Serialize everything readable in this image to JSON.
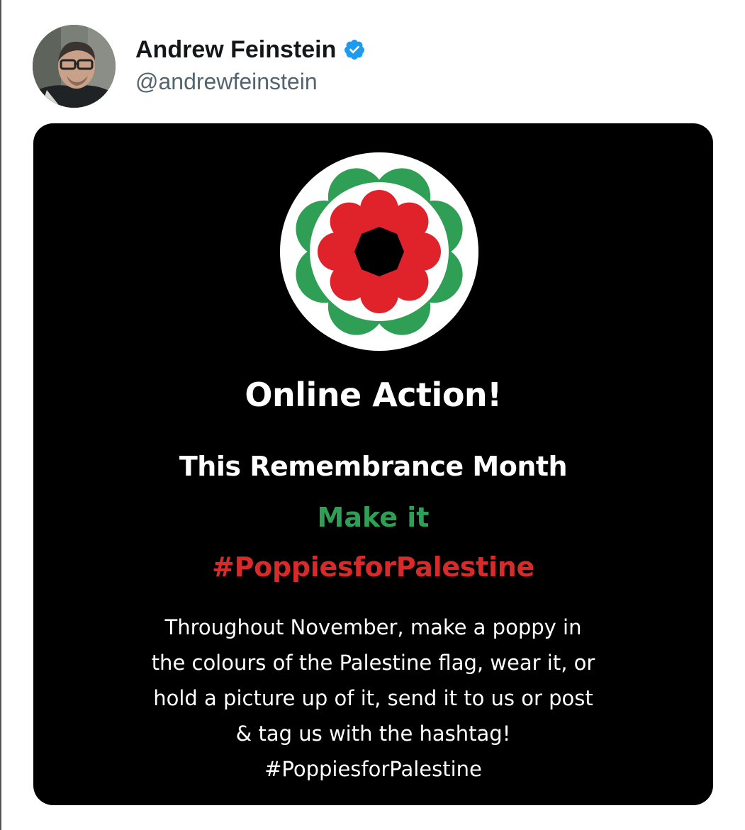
{
  "tweet": {
    "author": {
      "display_name": "Andrew Feinstein",
      "handle": "@andrewfeinstein",
      "verified": true,
      "verified_color": "#1d9bf0"
    },
    "media": {
      "headline": "Online Action!",
      "subheadline": "This Remembrance Month",
      "make_it": "Make it",
      "hashtag": "#PoppiesforPalestine",
      "body_lines": [
        "Throughout November, make a poppy in",
        "the colours of the Palestine flag, wear it, or",
        "hold a picture up of it, send it to us or post",
        "& tag us with the hashtag!",
        "#PoppiesforPalestine"
      ],
      "colors": {
        "background": "#000000",
        "green": "#2f9f55",
        "red": "#d72a2a",
        "white": "#ffffff"
      }
    }
  }
}
